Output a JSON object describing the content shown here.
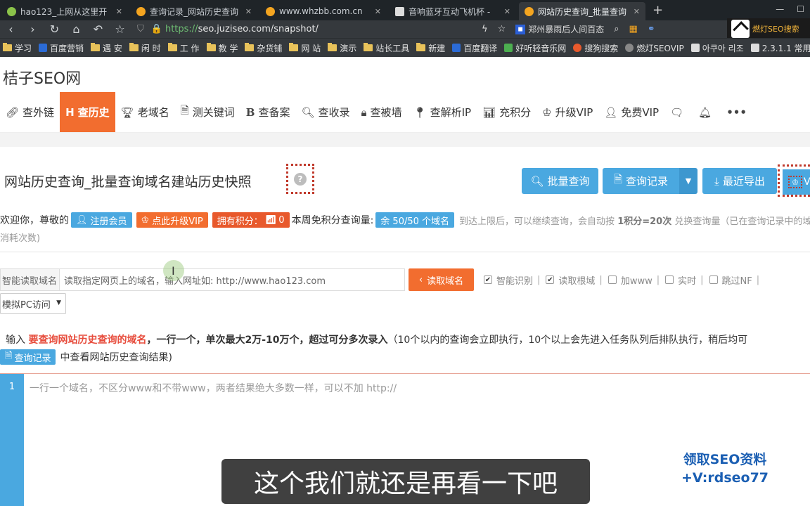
{
  "browser": {
    "tabs": [
      {
        "title": "hao123_上网从这里开",
        "color": "#8bc34a",
        "active": false
      },
      {
        "title": "查询记录_网站历史查询",
        "color": "#f4a520",
        "active": false
      },
      {
        "title": "www.whzbb.com.cn",
        "color": "#f4a520",
        "active": false
      },
      {
        "title": "音响蓝牙互动飞机杯 - ",
        "color": "#dddddd",
        "active": false
      },
      {
        "title": "网站历史查询_批量查询",
        "color": "#f4a520",
        "active": true
      }
    ],
    "new_tab": "+",
    "url_protocol": "https://",
    "url_rest": "seo.juziseo.com/snapshot/",
    "news_ticker": "郑州暴雨后人间百态",
    "extension_text": "燃灯SEO搜索"
  },
  "bookmarks": [
    {
      "label": "学习",
      "type": "folder"
    },
    {
      "label": "百度营销",
      "type": "site",
      "color": "#2b6bd6"
    },
    {
      "label": "遇 安",
      "type": "folder"
    },
    {
      "label": "闲 时",
      "type": "folder"
    },
    {
      "label": "工 作",
      "type": "folder"
    },
    {
      "label": "教 学",
      "type": "folder"
    },
    {
      "label": "杂货铺",
      "type": "folder"
    },
    {
      "label": "网 站",
      "type": "folder"
    },
    {
      "label": "演示",
      "type": "folder"
    },
    {
      "label": "站长工具",
      "type": "folder"
    },
    {
      "label": "新建",
      "type": "folder"
    },
    {
      "label": "百度翻译",
      "type": "site",
      "color": "#2b6bd6"
    },
    {
      "label": "好听轻音乐网",
      "type": "site",
      "color": "#4caf50"
    },
    {
      "label": "搜狗搜索",
      "type": "site",
      "color": "#e8592c"
    },
    {
      "label": "燃灯SEOVIP",
      "type": "site",
      "color": "#888888"
    },
    {
      "label": "아쿠아 리조",
      "type": "site",
      "color": "#dddddd"
    },
    {
      "label": "2.3.1.1 常用",
      "type": "site",
      "color": "#dddddd"
    }
  ],
  "site": {
    "logo": "桔子SEO网",
    "menu": [
      {
        "label": "查外链",
        "icon": "🔗",
        "active": false,
        "name": "link"
      },
      {
        "label": "查历史",
        "icon": "H",
        "active": true,
        "name": "history"
      },
      {
        "label": "老域名",
        "icon": "🏆",
        "active": false,
        "name": "old-domain"
      },
      {
        "label": "测关键词",
        "icon": "🗎",
        "active": false,
        "name": "keyword"
      },
      {
        "label": "查备案",
        "icon": "B",
        "active": false,
        "name": "icp"
      },
      {
        "label": "查收录",
        "icon": "🔍",
        "active": false,
        "name": "index"
      },
      {
        "label": "查被墙",
        "icon": "🔒",
        "active": false,
        "name": "blocked"
      },
      {
        "label": "查解析IP",
        "icon": "📍",
        "active": false,
        "name": "dns-ip"
      },
      {
        "label": "充积分",
        "icon": "📊",
        "active": false,
        "name": "recharge"
      },
      {
        "label": "升级VIP",
        "icon": "♔",
        "active": false,
        "name": "upgrade-vip"
      },
      {
        "label": "免费VIP",
        "icon": "👤",
        "active": false,
        "name": "free-vip"
      }
    ],
    "menu_extra_icons": [
      "chat-icon",
      "bell-icon",
      "more-icon"
    ],
    "page_title": "网站历史查询_批量查询域名建站历史快照",
    "help": "?",
    "buttons": {
      "batch": "批量查询",
      "records": "查询记录",
      "export": "最近导出",
      "vip": "V"
    },
    "welcome": {
      "prefix": "欢迎你，尊敬的",
      "register": "注册会员",
      "upgrade": "点此升级VIP",
      "points": "拥有积分：",
      "points_value": "0",
      "weekly": "本周免积分查询量:",
      "remaining": "余 50/50 个域名",
      "note_a": "到达上限后，可以继续查询，会自动按",
      "note_b": "1积分=20次",
      "note_c": "兑换查询量（已在查询记录中的域",
      "line2": "消耗次数)"
    },
    "reader": {
      "label": "智能读取域名",
      "placeholder": "读取指定网页上的域名，输入网址如: http://www.hao123.com",
      "button": "读取域名",
      "options": [
        {
          "label": "智能识别",
          "checked": true
        },
        {
          "label": "读取根域",
          "checked": true
        },
        {
          "label": "加www",
          "checked": false
        },
        {
          "label": "实时",
          "checked": false
        },
        {
          "label": "跳过NF",
          "checked": false
        }
      ],
      "ua_select": "模拟PC访问"
    },
    "instructions": {
      "a": "输入",
      "b": "要查询网站历史查询的域名",
      "c": "，一行一个，单次最大2万-10万个，超过可分多次录入",
      "d": "（10个以内的查询会立即执行，10个以上会先进入任务队列后排队执行，稍后均可",
      "record_badge": "查询记录",
      "e": "中查看网站历史查询结果)"
    },
    "editor": {
      "line_number": "1",
      "placeholder": "一行一个域名，不区分www和不带www，两者结果绝大多数一样，可以不加 http://"
    }
  },
  "overlay": {
    "watermark_1": "领取SEO资料",
    "watermark_2": "+V:rdseo77",
    "subtitle": "这个我们就还是再看一下吧"
  }
}
